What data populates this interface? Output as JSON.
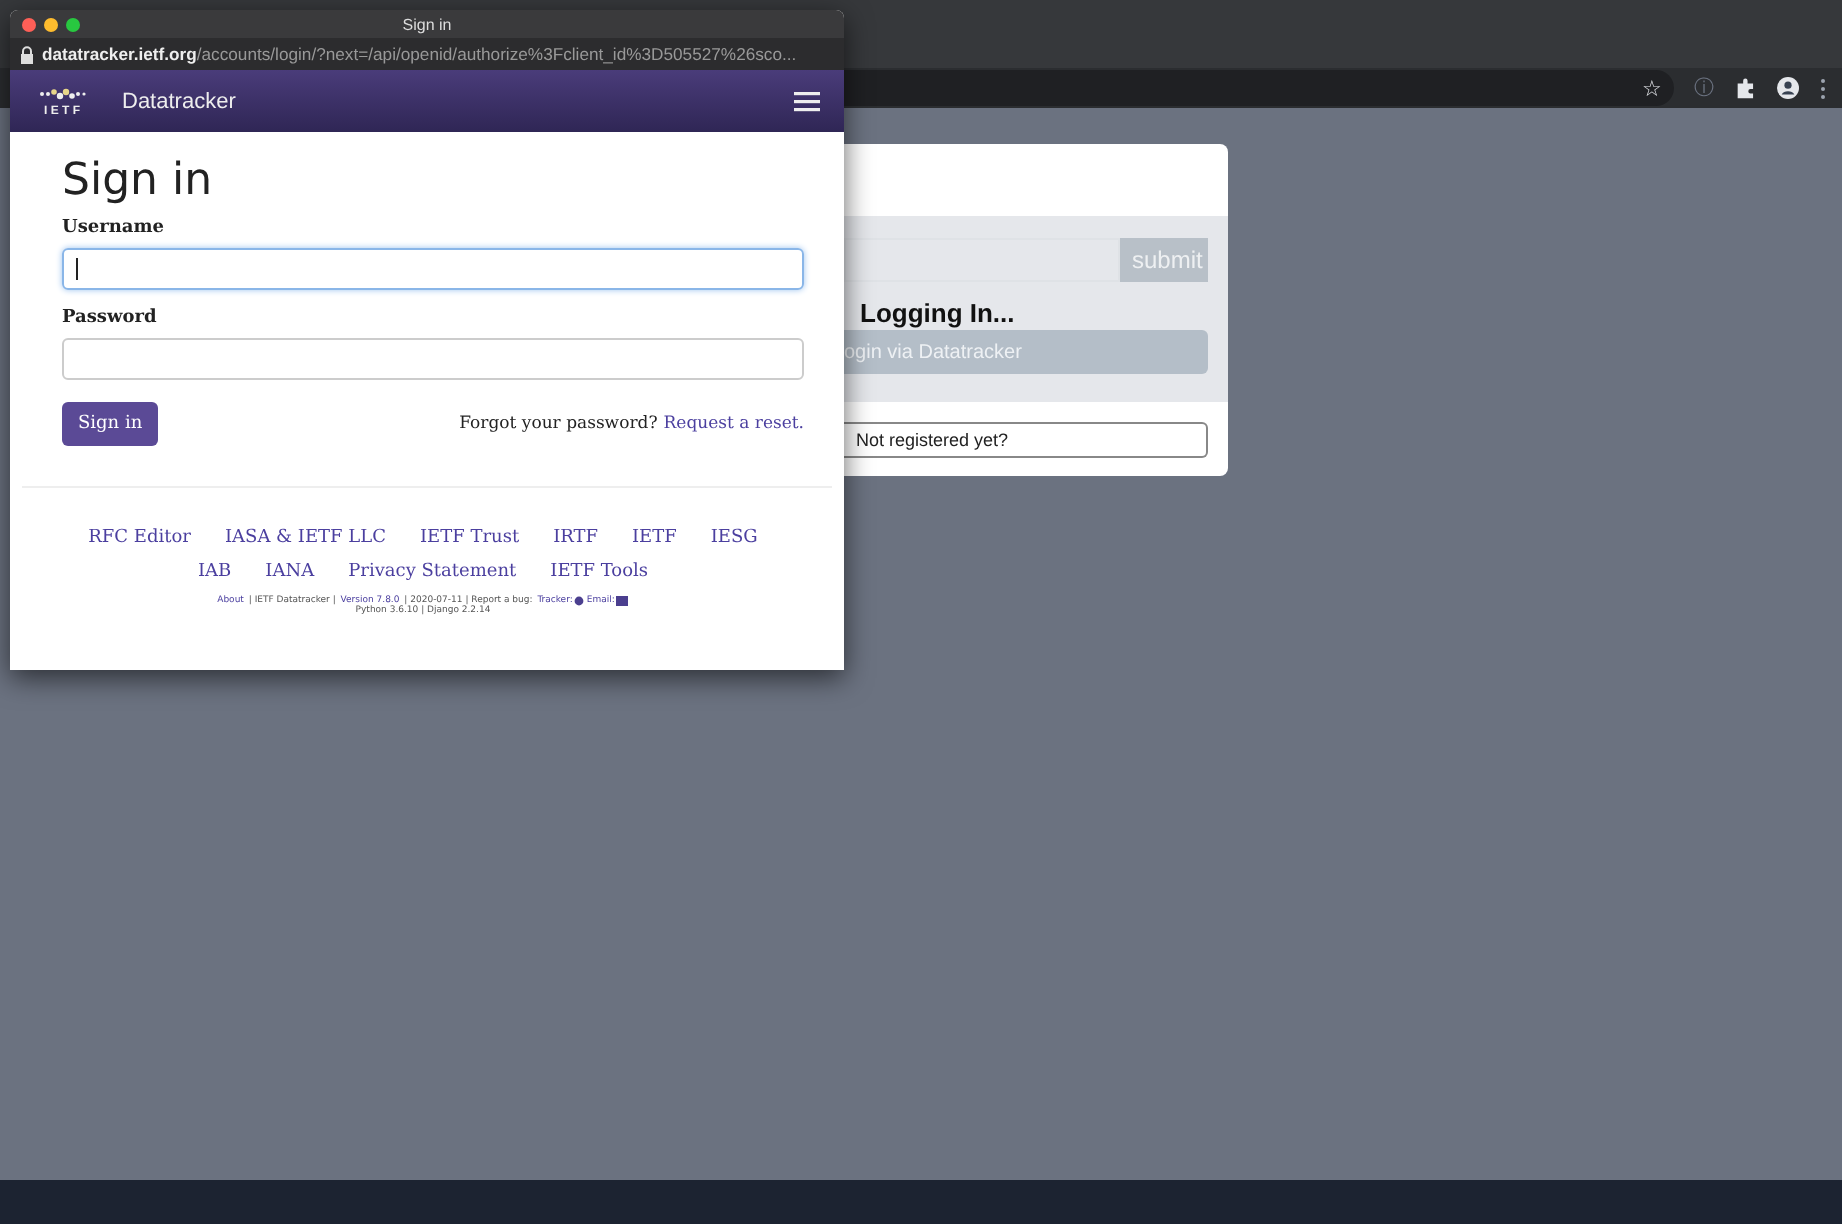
{
  "browser": {
    "toolbar_icons": [
      "☆",
      "ⓘ"
    ]
  },
  "background_card": {
    "submit": "submit",
    "status": "Logging In...",
    "login_button": "ogin via Datatracker",
    "register_button": "Not registered yet?"
  },
  "popup": {
    "title": "Sign in",
    "url_host": "datatracker.ietf.org",
    "url_path": "/accounts/login/?next=/api/openid/authorize%3Fclient_id%3D505527%26sco...",
    "brand": {
      "logo_text": "I E T F",
      "name": "Datatracker"
    },
    "heading": "Sign in",
    "fields": [
      {
        "label": "Username",
        "focused": true
      },
      {
        "label": "Password",
        "focused": false
      }
    ],
    "submit": "Sign in",
    "forgot": "Forgot your password?",
    "reset_link": "Request a reset.",
    "footer_links": [
      [
        "RFC Editor",
        "IASA & IETF LLC",
        "IETF Trust",
        "IRTF",
        "IETF",
        "IESG"
      ],
      [
        "IAB",
        "IANA",
        "Privacy Statement",
        "IETF Tools"
      ]
    ],
    "meta_line1": [
      {
        "text": "About",
        "link": true
      },
      {
        "text": " | IETF Datatracker | ",
        "link": false
      },
      {
        "text": "Version 7.8.0",
        "link": true
      },
      {
        "text": " | 2020-07-11 | Report a bug: ",
        "link": false
      },
      {
        "text": "Tracker:",
        "link": true
      },
      {
        "text": "Email:",
        "link": true
      }
    ],
    "meta_line2": "Python 3.6.10 | Django 2.2.14"
  }
}
